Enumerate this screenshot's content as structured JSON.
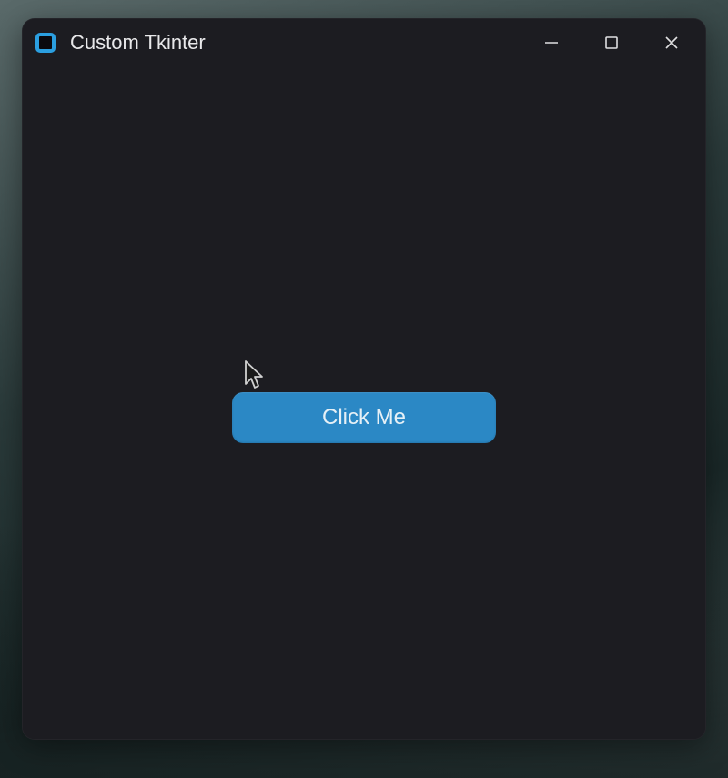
{
  "window": {
    "title": "Custom Tkinter"
  },
  "main": {
    "button_label": "Click Me"
  }
}
